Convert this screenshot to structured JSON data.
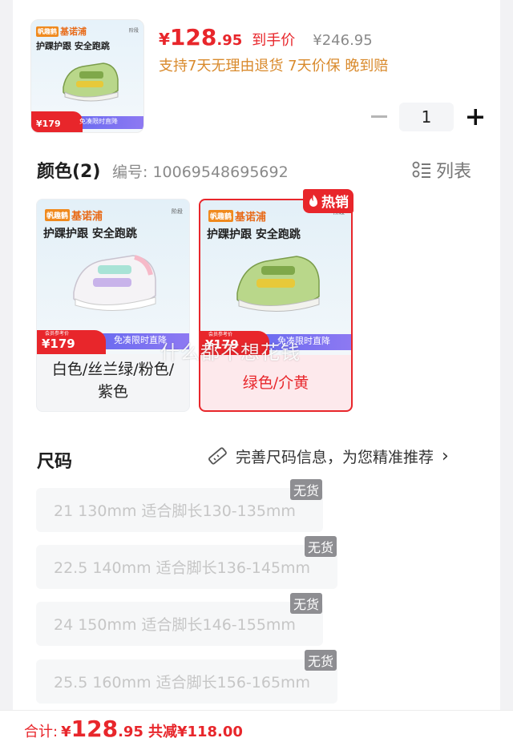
{
  "product": {
    "brand": "基诺浦",
    "brand_logo": "帆趣鹤",
    "slogan": "护踝护跟 安全跑跳",
    "stage": "阶段",
    "thumb_price": "¥179",
    "thumb_banner": "免凑限时直降"
  },
  "price": {
    "currency": "¥",
    "integer": "128",
    "decimal": ".95",
    "label": "到手价",
    "original": "¥246.95"
  },
  "promise": "支持7天无理由退货 7天价保 晚到赔",
  "quantity": {
    "minus_icon": "minus-icon",
    "value": "1",
    "plus_icon": "plus-icon"
  },
  "color_section": {
    "title": "颜色(2)",
    "sku": "编号: 10069548695692",
    "view_toggle": "列表",
    "hot_badge": "热销",
    "options": [
      {
        "label": "白色/丝兰绿/粉色/紫色",
        "price": "¥179",
        "banner": "免凑限时直降",
        "selected": false
      },
      {
        "label": "绿色/介黄",
        "price": "¥179",
        "banner": "免凑限时直降",
        "selected": true
      }
    ],
    "tiny_note": "会员参考价"
  },
  "watermark": "什么都不想花钱",
  "size_section": {
    "title": "尺码",
    "hint": "完善尺码信息，为您精准推荐",
    "chevron": "›",
    "out_of_stock": "无货",
    "options": [
      "21 130mm 适合脚长130-135mm",
      "22.5 140mm 适合脚长136-145mm",
      "24 150mm 适合脚长146-155mm",
      "25.5 160mm 适合脚长156-165mm"
    ]
  },
  "footer": {
    "total_label": "合计:",
    "currency": "¥",
    "integer": "128",
    "decimal": ".95",
    "saving": "共减¥118.00"
  },
  "colors": {
    "accent": "#e8262b",
    "promise": "#d98a2c",
    "muted": "#8a8a8a"
  }
}
